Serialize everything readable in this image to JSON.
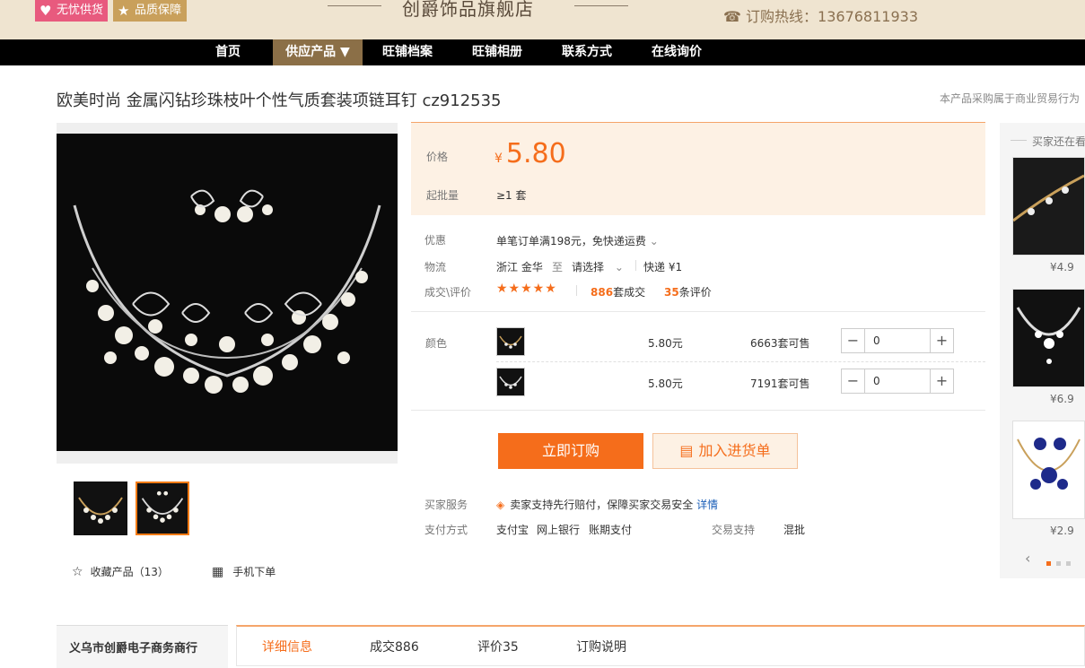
{
  "topbar": {
    "badge_1": "无忧供货",
    "badge_2": "品质保障",
    "shop_name": "创爵饰品旗舰店",
    "hotline": "订购热线：13676811933"
  },
  "nav": {
    "items": [
      "首页",
      "供应产品 ▼",
      "旺铺档案",
      "旺铺相册",
      "联系方式",
      "在线询价"
    ]
  },
  "product": {
    "title": "欧美时尚 金属闪钻珍珠枝叶个性气质套装项链耳钉 cz912535",
    "note": "本产品采购属于商业贸易行为",
    "favorites": "收藏产品（13）",
    "mobile_order": "手机下单"
  },
  "price_box": {
    "price_label": "价格",
    "currency": "¥",
    "price": "5.80",
    "moq_label": "起批量",
    "moq": "≥1 套"
  },
  "info": {
    "promo_label": "优惠",
    "promo": "单笔订单满198元，免快递运费",
    "logistics_label": "物流",
    "origin": "浙江 金华",
    "to": "至",
    "dest": "请选择",
    "express": "快递 ¥1",
    "deals_label": "成交\\评价",
    "stars": "★★★★★",
    "deals_num": "886",
    "deals_unit": "套成交",
    "reviews_num": "35",
    "reviews_unit": "条评价"
  },
  "variants": {
    "label": "颜色",
    "rows": [
      {
        "price": "5.80元",
        "stock": "6663套可售",
        "qty": "0"
      },
      {
        "price": "5.80元",
        "stock": "7191套可售",
        "qty": "0"
      }
    ]
  },
  "buttons": {
    "order": "立即订购",
    "cart": "加入进货单"
  },
  "services": {
    "buyer_label": "买家服务",
    "buyer_text": "卖家支持先行赔付，保障买家交易安全",
    "detail_link": "详情",
    "pay_label": "支付方式",
    "pay_1": "支付宝",
    "pay_2": "网上银行",
    "pay_3": "账期支付",
    "trade_label": "交易支持",
    "trade_value": "混批"
  },
  "sidebar": {
    "heading": "买家还在看",
    "prices": [
      "¥4.9",
      "¥6.9",
      "¥2.9"
    ]
  },
  "shop": {
    "name": "义乌市创爵电子商务商行"
  },
  "tabs": [
    "详细信息",
    "成交886",
    "评价35",
    "订购说明"
  ],
  "colors": {
    "accent": "#f56d1b",
    "nav_bg": "#000000",
    "nav_active": "#8b6f47",
    "topbar_bg": "#efe4d0",
    "price_bg": "#fdf1e4"
  }
}
